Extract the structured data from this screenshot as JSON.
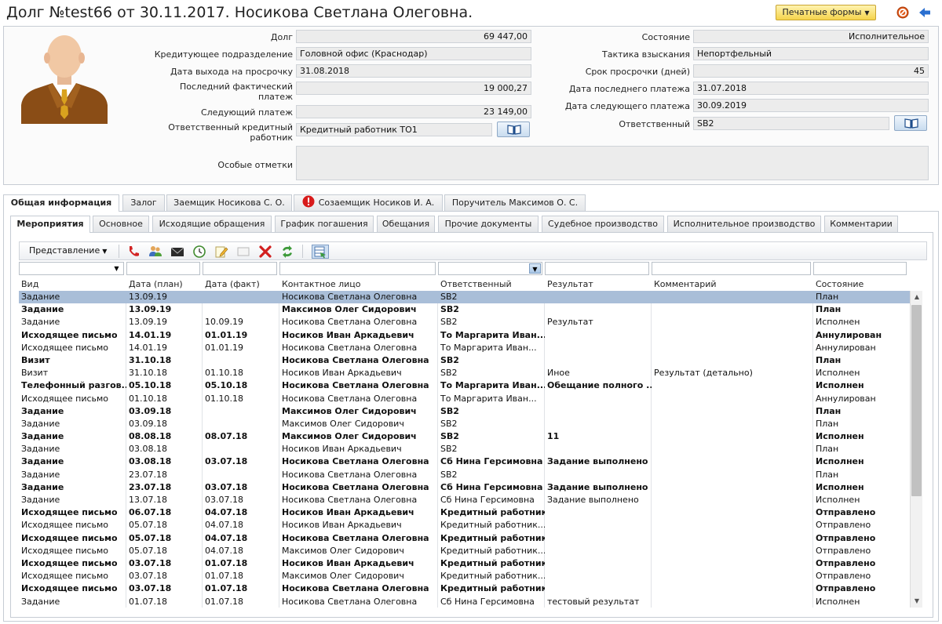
{
  "header": {
    "title": "Долг №test66 от 30.11.2017. Носикова Светлана Олеговна.",
    "print_forms": "Печатные формы"
  },
  "icons": {
    "avatar": "person-avatar-icon",
    "book": "book-icon",
    "cancel": "cancel-icon",
    "back": "back-arrow-icon",
    "warning": "warning-icon"
  },
  "colors": {
    "selected_row": "#a9bed8",
    "print_button": "#f5d44c",
    "cancel": "#e05a1a",
    "back": "#2a6fd0",
    "warning": "#d81b1b"
  },
  "fields": {
    "debt_label": "Долг",
    "debt_value": "69 447,00",
    "credit_unit_label": "Кредитующее подразделение",
    "credit_unit_value": "Головной офис (Краснодар)",
    "overdue_date_label": "Дата выхода на просрочку",
    "overdue_date_value": "31.08.2018",
    "last_payment_label": "Последний фактический платеж",
    "last_payment_value": "19 000,27",
    "next_payment_label": "Следующий платеж",
    "next_payment_value": "23 149,00",
    "resp_officer_label": "Ответственный кредитный работник",
    "resp_officer_value": "Кредитный работник ТО1",
    "notes_label": "Особые отметки",
    "notes_value": "",
    "state_label": "Состояние",
    "state_value": "Исполнительное",
    "tactic_label": "Тактика взыскания",
    "tactic_value": "Непортфельный",
    "overdue_days_label": "Срок просрочки (дней)",
    "overdue_days_value": "45",
    "last_payment_date_label": "Дата последнего платежа",
    "last_payment_date_value": "31.07.2018",
    "next_payment_date_label": "Дата следующего платежа",
    "next_payment_date_value": "30.09.2019",
    "responsible_label": "Ответственный",
    "responsible_value": "SB2"
  },
  "outer_tabs": [
    {
      "label": "Общая информация"
    },
    {
      "label": "Залог"
    },
    {
      "label": "Заемщик Носикова С. О."
    },
    {
      "label": "Созаемщик Носиков И. А."
    },
    {
      "label": "Поручитель Максимов О. С."
    }
  ],
  "inner_tabs": [
    {
      "label": "Мероприятия"
    },
    {
      "label": "Основное"
    },
    {
      "label": "Исходящие обращения"
    },
    {
      "label": "График погашения"
    },
    {
      "label": "Обещания"
    },
    {
      "label": "Прочие документы"
    },
    {
      "label": "Судебное производство"
    },
    {
      "label": "Исполнительное производство"
    },
    {
      "label": "Комментарии"
    }
  ],
  "toolbar": {
    "view_label": "Представление"
  },
  "table": {
    "columns": [
      "Вид",
      "Дата (план)",
      "Дата (факт)",
      "Контактное лицо",
      "Ответственный",
      "Результат",
      "Комментарий",
      "Состояние"
    ],
    "rows": [
      {
        "bold": false,
        "selected": true,
        "cells": [
          "Задание",
          "13.09.19",
          "",
          "Носикова Светлана Олеговна",
          "SB2",
          "",
          "",
          "План"
        ]
      },
      {
        "bold": true,
        "selected": false,
        "cells": [
          "Задание",
          "13.09.19",
          "",
          "Максимов Олег Сидорович",
          "SB2",
          "",
          "",
          "План"
        ]
      },
      {
        "bold": false,
        "selected": false,
        "cells": [
          "Задание",
          "13.09.19",
          "10.09.19",
          "Носикова Светлана Олеговна",
          "SB2",
          "Результат",
          "",
          "Исполнен"
        ]
      },
      {
        "bold": true,
        "selected": false,
        "cells": [
          "Исходящее письмо",
          "14.01.19",
          "01.01.19",
          "Носиков Иван Аркадьевич",
          "То Маргарита Иван...",
          "",
          "",
          "Аннулирован"
        ]
      },
      {
        "bold": false,
        "selected": false,
        "cells": [
          "Исходящее письмо",
          "14.01.19",
          "01.01.19",
          "Носикова Светлана Олеговна",
          "То Маргарита Иван...",
          "",
          "",
          "Аннулирован"
        ]
      },
      {
        "bold": true,
        "selected": false,
        "cells": [
          "Визит",
          "31.10.18",
          "",
          "Носикова Светлана Олеговна",
          "SB2",
          "",
          "",
          "План"
        ]
      },
      {
        "bold": false,
        "selected": false,
        "cells": [
          "Визит",
          "31.10.18",
          "01.10.18",
          "Носиков Иван Аркадьевич",
          "SB2",
          "Иное",
          "Результат (детально)",
          "Исполнен"
        ]
      },
      {
        "bold": true,
        "selected": false,
        "cells": [
          "Телефонный разгов...",
          "05.10.18",
          "05.10.18",
          "Носикова Светлана Олеговна",
          "То Маргарита Иван...",
          "Обещание полного ...",
          "",
          "Исполнен"
        ]
      },
      {
        "bold": false,
        "selected": false,
        "cells": [
          "Исходящее письмо",
          "01.10.18",
          "01.10.18",
          "Носикова Светлана Олеговна",
          "То Маргарита Иван...",
          "",
          "",
          "Аннулирован"
        ]
      },
      {
        "bold": true,
        "selected": false,
        "cells": [
          "Задание",
          "03.09.18",
          "",
          "Максимов Олег Сидорович",
          "SB2",
          "",
          "",
          "План"
        ]
      },
      {
        "bold": false,
        "selected": false,
        "cells": [
          "Задание",
          "03.09.18",
          "",
          "Максимов Олег Сидорович",
          "SB2",
          "",
          "",
          "План"
        ]
      },
      {
        "bold": true,
        "selected": false,
        "cells": [
          "Задание",
          "08.08.18",
          "08.07.18",
          "Максимов Олег Сидорович",
          "SB2",
          "11",
          "",
          "Исполнен"
        ]
      },
      {
        "bold": false,
        "selected": false,
        "cells": [
          "Задание",
          "03.08.18",
          "",
          "Носиков Иван Аркадьевич",
          "SB2",
          "",
          "",
          "План"
        ]
      },
      {
        "bold": true,
        "selected": false,
        "cells": [
          "Задание",
          "03.08.18",
          "03.07.18",
          "Носикова Светлана Олеговна",
          "Сб Нина Герсимовна",
          "Задание выполнено",
          "",
          "Исполнен"
        ]
      },
      {
        "bold": false,
        "selected": false,
        "cells": [
          "Задание",
          "23.07.18",
          "",
          "Носикова Светлана Олеговна",
          "SB2",
          "",
          "",
          "План"
        ]
      },
      {
        "bold": true,
        "selected": false,
        "cells": [
          "Задание",
          "23.07.18",
          "03.07.18",
          "Носикова Светлана Олеговна",
          "Сб Нина Герсимовна",
          "Задание выполнено",
          "",
          "Исполнен"
        ]
      },
      {
        "bold": false,
        "selected": false,
        "cells": [
          "Задание",
          "13.07.18",
          "03.07.18",
          "Носикова Светлана Олеговна",
          "Сб Нина Герсимовна",
          "Задание выполнено",
          "",
          "Исполнен"
        ]
      },
      {
        "bold": true,
        "selected": false,
        "cells": [
          "Исходящее письмо",
          "06.07.18",
          "04.07.18",
          "Носиков Иван Аркадьевич",
          "Кредитный работник...",
          "",
          "",
          "Отправлено"
        ]
      },
      {
        "bold": false,
        "selected": false,
        "cells": [
          "Исходящее письмо",
          "05.07.18",
          "04.07.18",
          "Носиков Иван Аркадьевич",
          "Кредитный работник...",
          "",
          "",
          "Отправлено"
        ]
      },
      {
        "bold": true,
        "selected": false,
        "cells": [
          "Исходящее письмо",
          "05.07.18",
          "04.07.18",
          "Носикова Светлана Олеговна",
          "Кредитный работник...",
          "",
          "",
          "Отправлено"
        ]
      },
      {
        "bold": false,
        "selected": false,
        "cells": [
          "Исходящее письмо",
          "05.07.18",
          "04.07.18",
          "Максимов Олег Сидорович",
          "Кредитный работник...",
          "",
          "",
          "Отправлено"
        ]
      },
      {
        "bold": true,
        "selected": false,
        "cells": [
          "Исходящее письмо",
          "03.07.18",
          "01.07.18",
          "Носиков Иван Аркадьевич",
          "Кредитный работник...",
          "",
          "",
          "Отправлено"
        ]
      },
      {
        "bold": false,
        "selected": false,
        "cells": [
          "Исходящее письмо",
          "03.07.18",
          "01.07.18",
          "Максимов Олег Сидорович",
          "Кредитный работник...",
          "",
          "",
          "Отправлено"
        ]
      },
      {
        "bold": true,
        "selected": false,
        "cells": [
          "Исходящее письмо",
          "03.07.18",
          "01.07.18",
          "Носикова Светлана Олеговна",
          "Кредитный работник...",
          "",
          "",
          "Отправлено"
        ]
      },
      {
        "bold": false,
        "selected": false,
        "cells": [
          "Задание",
          "01.07.18",
          "01.07.18",
          "Носикова Светлана Олеговна",
          "Сб Нина Герсимовна",
          "тестовый результат",
          "",
          "Исполнен"
        ]
      }
    ]
  }
}
